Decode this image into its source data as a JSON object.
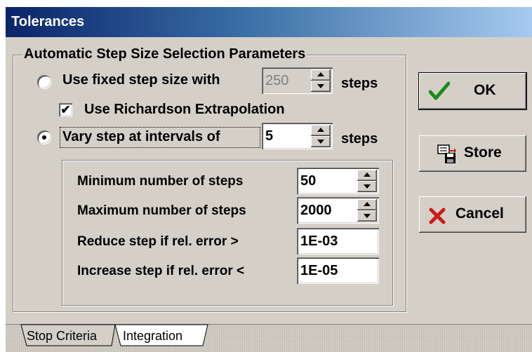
{
  "window": {
    "title": "Tolerances"
  },
  "group": {
    "legend": "Automatic Step Size Selection Parameters",
    "fixed_step": {
      "label": "Use fixed step size with",
      "value": "250",
      "unit": "steps",
      "selected": false,
      "enabled": false
    },
    "richardson": {
      "label": "Use Richardson Extrapolation",
      "checked": true
    },
    "vary_step": {
      "label": "Vary step at intervals of",
      "value": "5",
      "unit": "steps",
      "selected": true
    },
    "params": {
      "min_steps": {
        "label": "Minimum number of steps",
        "value": "50"
      },
      "max_steps": {
        "label": "Maximum number of steps",
        "value": "2000"
      },
      "reduce_step": {
        "label": "Reduce step if rel. error >",
        "value": "1E-03"
      },
      "increase_step": {
        "label": "Increase step if rel. error <",
        "value": "1E-05"
      }
    }
  },
  "buttons": {
    "ok": {
      "label": "OK",
      "icon": "checkmark-icon",
      "color": "#1a8a1a"
    },
    "store": {
      "label": "Store",
      "icon": "store-icon"
    },
    "cancel": {
      "label": "Cancel",
      "icon": "x-icon",
      "color": "#cc1a1a"
    }
  },
  "tabs": [
    {
      "label": "Stop Criteria",
      "active": false
    },
    {
      "label": "Integration",
      "active": true
    }
  ]
}
